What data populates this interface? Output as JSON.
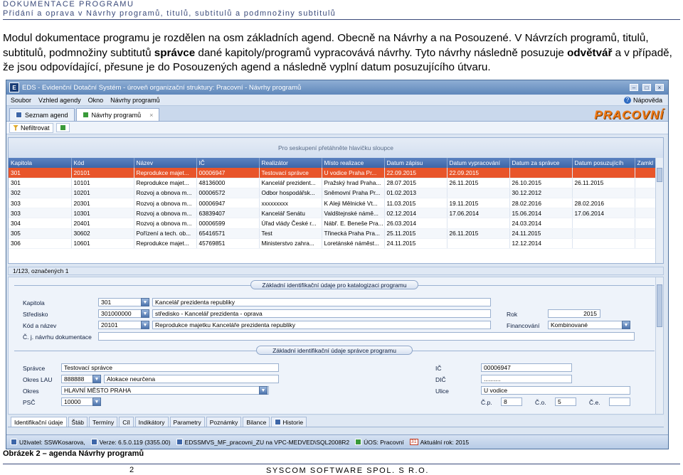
{
  "doc": {
    "header_line1": "DOKUMENTACE PROGRAMU",
    "header_line2": "Přidání a oprava v Návrhy programů, titulů, subtitulů a podmnožiny subtitulů",
    "para_1": "Modul dokumentace programu je rozdělen na osm základních agend. Obecně na Návrhy a na Posouzené. V Návrzích programů, titulů, subtitulů, podmnožiny subtitutů ",
    "para_b1": "správce",
    "para_2": " dané kapitoly/programů vypracovává návrhy. Tyto návrhy následně posuzuje ",
    "para_b2": "odvětvář",
    "para_3": " a v případě, že jsou odpovídající, přesune je do Posouzených agend a následně vyplní datum posuzujícího útvaru.",
    "caption": "Obrázek 2 – agenda Návrhy programů",
    "page_number": "2",
    "company": "SYSCOM SOFTWARE SPOL. S R.O."
  },
  "app": {
    "logo_letter": "E",
    "title": "EDS - Evidenční Dotační Systém - úroveň organizační struktury: Pracovní - Návrhy programů",
    "menu": [
      "Soubor",
      "Vzhled agendy",
      "Okno",
      "Návrhy programů"
    ],
    "help": "Nápověda",
    "tabs": [
      "Seznam agend",
      "Návrhy programů"
    ],
    "brand": "PRACOVNÍ",
    "filter_button": "Nefiltrovat",
    "group_hint": "Pro seskupení přetáhněte hlavičku sloupce",
    "columns": [
      "Kapitola",
      "Kód",
      "Název",
      "IČ",
      "Realizátor",
      "Místo realizace",
      "Datum zápisu",
      "Datum vypracování",
      "Datum za správce",
      "Datum posuzujícíh",
      "Zamkl"
    ],
    "rows": [
      [
        "301",
        "20101",
        "Reprodukce majet...",
        "00006947",
        "Testovací správce",
        "U vodice Praha Pr...",
        "22.09.2015",
        "22.09.2015",
        "",
        "",
        ""
      ],
      [
        "301",
        "10101",
        "Reprodukce majet...",
        "48136000",
        "Kancelář prezident...",
        "Pražský hrad Praha...",
        "28.07.2015",
        "26.11.2015",
        "26.10.2015",
        "26.11.2015",
        ""
      ],
      [
        "302",
        "10201",
        "Rozvoj a obnova m...",
        "00006572",
        "Odbor hospodářsk...",
        "Sněmovní Praha Pr...",
        "01.02.2013",
        "",
        "30.12.2012",
        "",
        ""
      ],
      [
        "303",
        "20301",
        "Rozvoj a obnova m...",
        "00006947",
        "xxxxxxxxx",
        "K Aleji Mělnické Vt...",
        "11.03.2015",
        "19.11.2015",
        "28.02.2016",
        "28.02.2016",
        ""
      ],
      [
        "303",
        "10301",
        "Rozvoj a obnova m...",
        "63839407",
        "Kancelář Senátu",
        "Valdštejnské námě...",
        "02.12.2014",
        "17.06.2014",
        "15.06.2014",
        "17.06.2014",
        ""
      ],
      [
        "304",
        "20401",
        "Rozvoj a obnova m...",
        "00006599",
        "Úřad vlády České r...",
        "Nábř. E. Beneše Pra...",
        "26.03.2014",
        "",
        "24.03.2014",
        "",
        ""
      ],
      [
        "305",
        "30602",
        "Pořízení a tech. ob...",
        "65416571",
        "Test",
        "Třinecká Praha Pra...",
        "25.11.2015",
        "26.11.2015",
        "24.11.2015",
        "",
        ""
      ],
      [
        "306",
        "10601",
        "Reprodukce majet...",
        "45769851",
        "Ministerstvo zahra...",
        "Loretánské náměst...",
        "24.11.2015",
        "",
        "12.12.2014",
        "",
        ""
      ]
    ],
    "record_status": "1/123, označených 1",
    "section1_title": "Základní identifikační údaje pro katalogizaci programu",
    "section2_title": "Základní identifikační údaje správce programu",
    "fields": {
      "kapitola_label": "Kapitola",
      "kapitola_code": "301",
      "kapitola_name": "Kancelář prezidenta republiky",
      "stredisko_label": "Středisko",
      "stredisko_code": "301000000",
      "stredisko_name": "středisko - Kancelář prezidenta - oprava",
      "rok_label": "Rok",
      "rok_value": "2015",
      "kod_label": "Kód a název",
      "kod_code": "20101",
      "kod_name": "Reprodukce majetku Kanceláře prezidenta republiky",
      "financovani_label": "Financování",
      "financovani_value": "Kombinované",
      "cj_label": "Č. j. návrhu dokumentace",
      "spravce_label": "Správce",
      "spravce_value": "Testovací správce",
      "ico_label": "IČ",
      "ico_value": "00006947",
      "okres_lau_label": "Okres LAU",
      "okres_lau_code": "888888",
      "okres_lau_name": "Alokace neurčena",
      "dic_label": "DIČ",
      "dic_value": "..........",
      "okres_label": "Okres",
      "okres_value": "HLAVNÍ MĚSTO PRAHA",
      "ulice_label": "Ulice",
      "ulice_value": "U vodice",
      "psc_label": "PSČ",
      "psc_value": "10000",
      "cp_label": "Č.p.",
      "cp_value": "8",
      "co_label": "Č.o.",
      "co_value": "5",
      "ce_label": "Č.e."
    },
    "bottom_tabs": [
      "Identifikační údaje",
      "Štáb",
      "Termíny",
      "Cíl",
      "Indikátory",
      "Parametry",
      "Poznámky",
      "Bilance",
      "Historie"
    ],
    "statusbar": {
      "user": "Uživatel: SSWKosarova,",
      "version": "Verze: 6.5.0.119 (3355.00)",
      "db": "EDSSMVS_MF_pracovni_ZU na VPC-MEDVED\\SQL2008R2",
      "uos": "ÚOS: Pracovní",
      "year_badge": "31",
      "year": "Aktuální rok: 2015"
    }
  }
}
